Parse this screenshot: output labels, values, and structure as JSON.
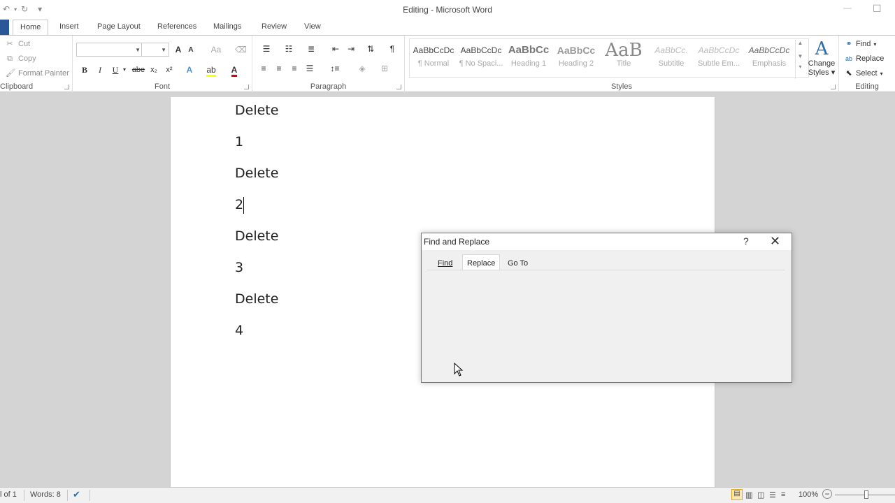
{
  "window": {
    "title": "Editing  -  Microsoft Word",
    "minimize": "—",
    "maximize": "☐"
  },
  "qat": {
    "undo_icon": "↶",
    "redo_icon": "↻",
    "customize_icon": "▾"
  },
  "ribbon_tabs": [
    "Home",
    "Insert",
    "Page Layout",
    "References",
    "Mailings",
    "Review",
    "View"
  ],
  "clipboard": {
    "cut": "Cut",
    "copy": "Copy",
    "format_painter": "Format Painter",
    "label": "Clipboard"
  },
  "font": {
    "font_name": "",
    "font_size": "",
    "grow": "A",
    "shrink": "A",
    "change_case": "Aa",
    "bold": "B",
    "italic": "I",
    "underline": "U",
    "strike": "abe",
    "subscript": "x₂",
    "superscript": "x²",
    "text_effects": "A",
    "font_color": "A",
    "label": "Font"
  },
  "paragraph": {
    "show_marks": "¶",
    "label": "Paragraph"
  },
  "styles": {
    "items": [
      {
        "sample": "AaBbCcDc",
        "name": "¶ Normal"
      },
      {
        "sample": "AaBbCcDc",
        "name": "¶ No Spaci..."
      },
      {
        "sample": "AaBbCc",
        "name": "Heading 1"
      },
      {
        "sample": "AaBbCc",
        "name": "Heading 2"
      },
      {
        "sample": "AaB",
        "name": "Title"
      },
      {
        "sample": "AaBbCc.",
        "name": "Subtitle"
      },
      {
        "sample": "AaBbCcDc",
        "name": "Subtle Em..."
      },
      {
        "sample": "AaBbCcDc",
        "name": "Emphasis"
      }
    ],
    "change_styles_line1": "Change",
    "change_styles_line2": "Styles",
    "label": "Styles"
  },
  "editing": {
    "find": "Find",
    "replace": "Replace",
    "select": "Select",
    "label": "Editing"
  },
  "document": {
    "lines": [
      "Delete",
      "1",
      "Delete",
      "2",
      "Delete",
      "3",
      "Delete",
      "4"
    ]
  },
  "dialog": {
    "title": "Find and Replace",
    "help": "?",
    "close": "✕",
    "tabs": [
      "Find",
      "Replace",
      "Go To"
    ],
    "active_tab": "Replace"
  },
  "statusbar": {
    "page": "l of 1",
    "words": "Words: 8",
    "zoom": "100%"
  }
}
